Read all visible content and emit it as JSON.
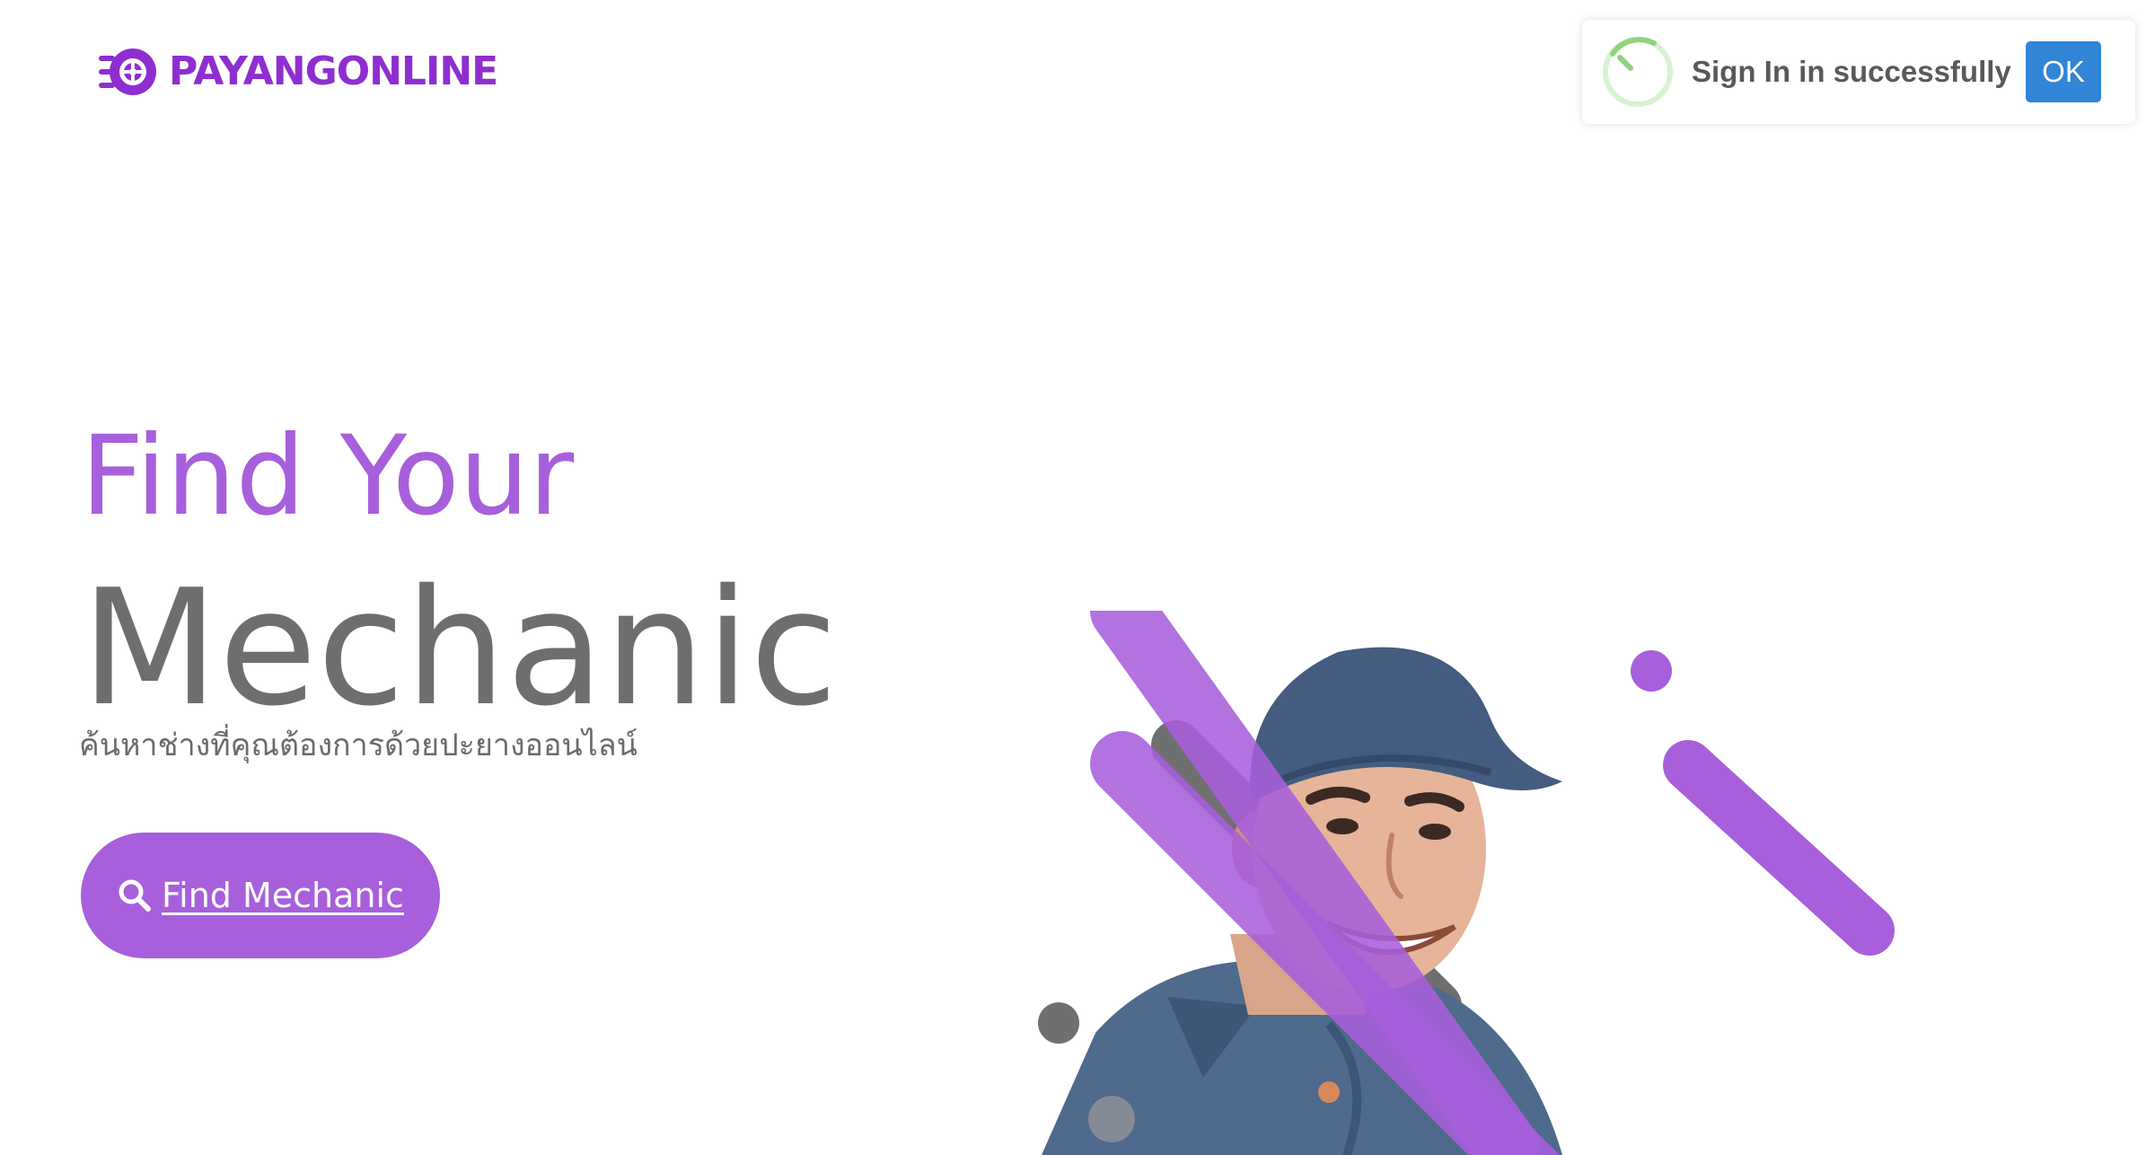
{
  "brand": {
    "name": "PAYANGONLINE",
    "color": "#8e2ed0"
  },
  "toast": {
    "message": "Sign In in successfully",
    "ok_label": "OK",
    "icon": "success-ring-icon"
  },
  "hero": {
    "title_line1": "Find Your",
    "title_line2": "Mechanic",
    "subtitle": "ค้นหาช่างที่คุณต้องการด้วยปะยางออนไลน์",
    "button_label": "Find Mechanic",
    "button_icon": "search-icon"
  },
  "colors": {
    "accent": "#a85fdc",
    "ok_button": "#3085d6",
    "title_gray": "#6e6e6e"
  }
}
